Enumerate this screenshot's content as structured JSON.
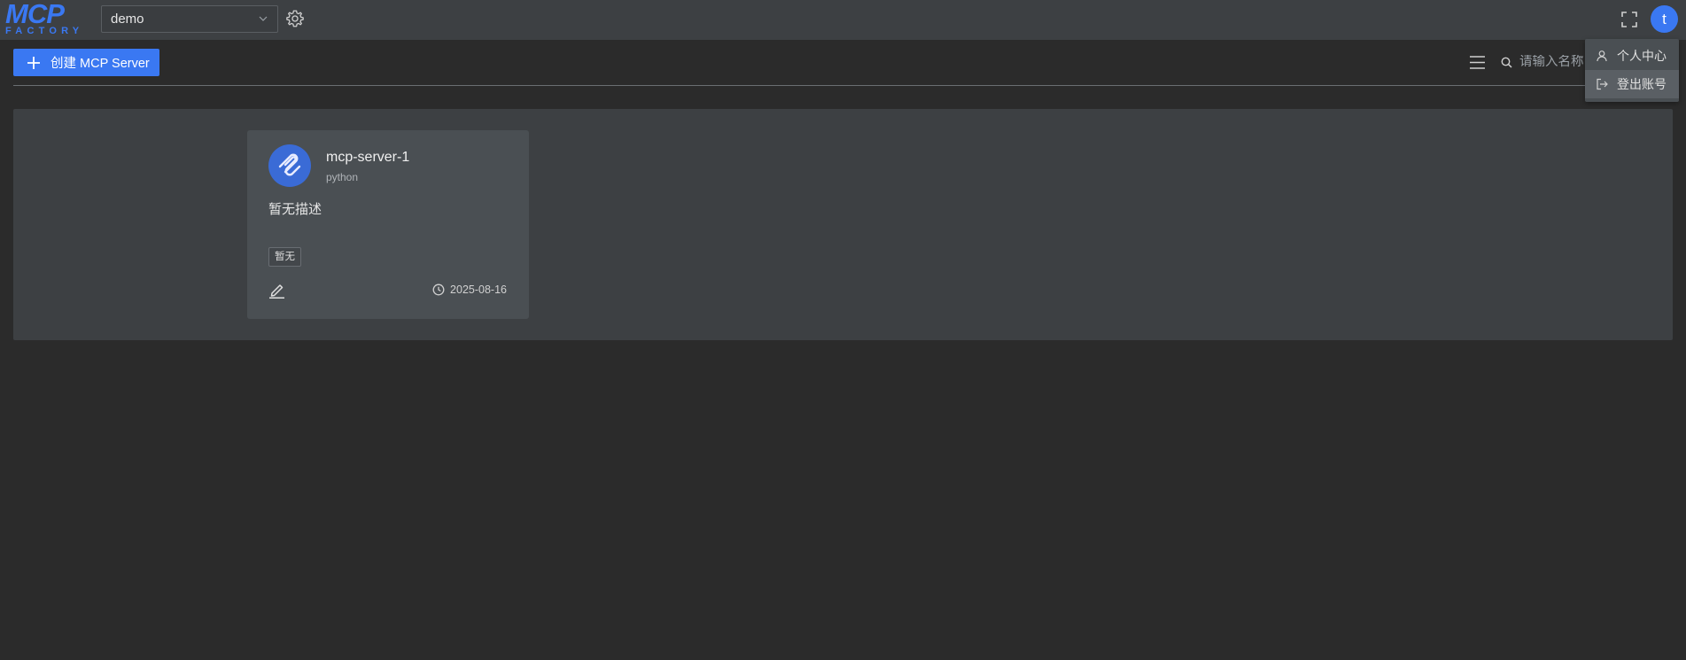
{
  "header": {
    "logo": {
      "top": "MCP",
      "bottom": "FACTORY"
    },
    "project_select": {
      "value": "demo"
    },
    "icons": {
      "settings": "gear-icon",
      "fullscreen": "fullscreen-icon",
      "dropdown": "chevron-down-icon"
    },
    "avatar_initial": "t"
  },
  "toolbar": {
    "create_label": "创建 MCP Server",
    "search_placeholder": "请输入名称"
  },
  "servers": [
    {
      "name": "mcp-server-1",
      "language": "python",
      "description": "暂无描述",
      "tag": "暂无",
      "date": "2025-08-16"
    }
  ],
  "user_menu": {
    "items": [
      {
        "label": "个人中心",
        "icon": "user-icon"
      },
      {
        "label": "登出账号",
        "icon": "logout-icon"
      }
    ]
  },
  "colors": {
    "accent": "#3a78f2",
    "background": "#2b2b2b",
    "header": "#3d4043",
    "card": "#4a4f53"
  }
}
